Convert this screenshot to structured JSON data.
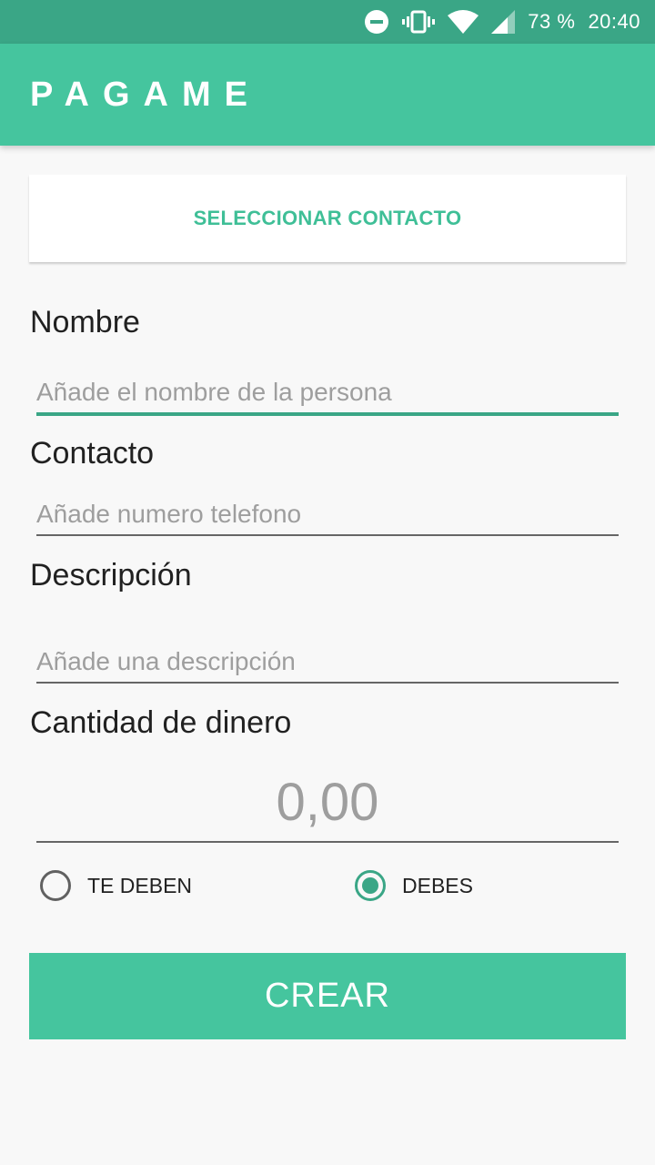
{
  "status_bar": {
    "battery": "73 %",
    "time": "20:40",
    "icons": [
      "do-not-disturb-icon",
      "vibrate-icon",
      "wifi-icon",
      "signal-icon"
    ]
  },
  "app_bar": {
    "title": "PAGAME"
  },
  "form": {
    "select_contact_label": "SELECCIONAR CONTACTO",
    "name": {
      "label": "Nombre",
      "placeholder": "Añade el nombre de la persona",
      "value": ""
    },
    "contact": {
      "label": "Contacto",
      "placeholder": "Añade numero telefono",
      "value": ""
    },
    "description": {
      "label": "Descripción",
      "placeholder": "Añade una descripción",
      "value": ""
    },
    "amount": {
      "label": "Cantidad de dinero",
      "placeholder": "0,00",
      "value": ""
    },
    "direction": {
      "options": [
        {
          "label": "TE DEBEN",
          "checked": false
        },
        {
          "label": "DEBES",
          "checked": true
        }
      ]
    },
    "submit_label": "CREAR"
  },
  "colors": {
    "status_bar": "#3aa686",
    "primary": "#45c59e",
    "accent": "#3aa686",
    "background": "#f8f8f8"
  }
}
